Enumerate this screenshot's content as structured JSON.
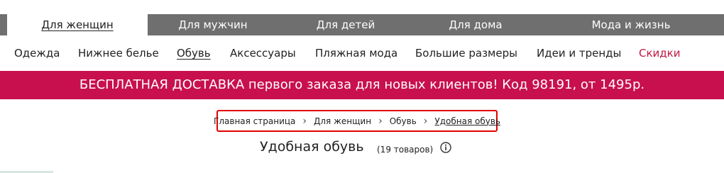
{
  "top_nav": {
    "tabs": [
      {
        "label": "Для женщин",
        "active": true
      },
      {
        "label": "Для мужчин",
        "active": false
      },
      {
        "label": "Для детей",
        "active": false
      },
      {
        "label": "Для дома",
        "active": false
      },
      {
        "label": "Мода и жизнь",
        "active": false
      }
    ],
    "bg_color": "#6f6f6f"
  },
  "sub_nav": {
    "items": [
      {
        "label": "Одежда"
      },
      {
        "label": "Нижнее белье"
      },
      {
        "label": "Обувь",
        "active": true
      },
      {
        "label": "Аксессуары"
      },
      {
        "label": "Пляжная мода"
      },
      {
        "label": "Большие размеры"
      },
      {
        "label": "Идеи и тренды"
      },
      {
        "label": "Скидки",
        "highlight": true
      }
    ],
    "sale_color": "#c0163f"
  },
  "promo": {
    "text": "БЕСПЛАТНАЯ ДОСТАВКА первого заказа для новых клиентов! Код 98191, от 1495р.",
    "bg_color": "#c8104e"
  },
  "breadcrumb": {
    "items": [
      {
        "label": "Главная страница"
      },
      {
        "label": "Для женщин"
      },
      {
        "label": "Обувь"
      },
      {
        "label": "Удобная обувь",
        "current": true
      }
    ],
    "separator": "›",
    "highlight_color": "#e00000"
  },
  "page": {
    "title": "Удобная обувь",
    "count": "(19 товаров)",
    "info_icon": "info-circle-icon"
  }
}
